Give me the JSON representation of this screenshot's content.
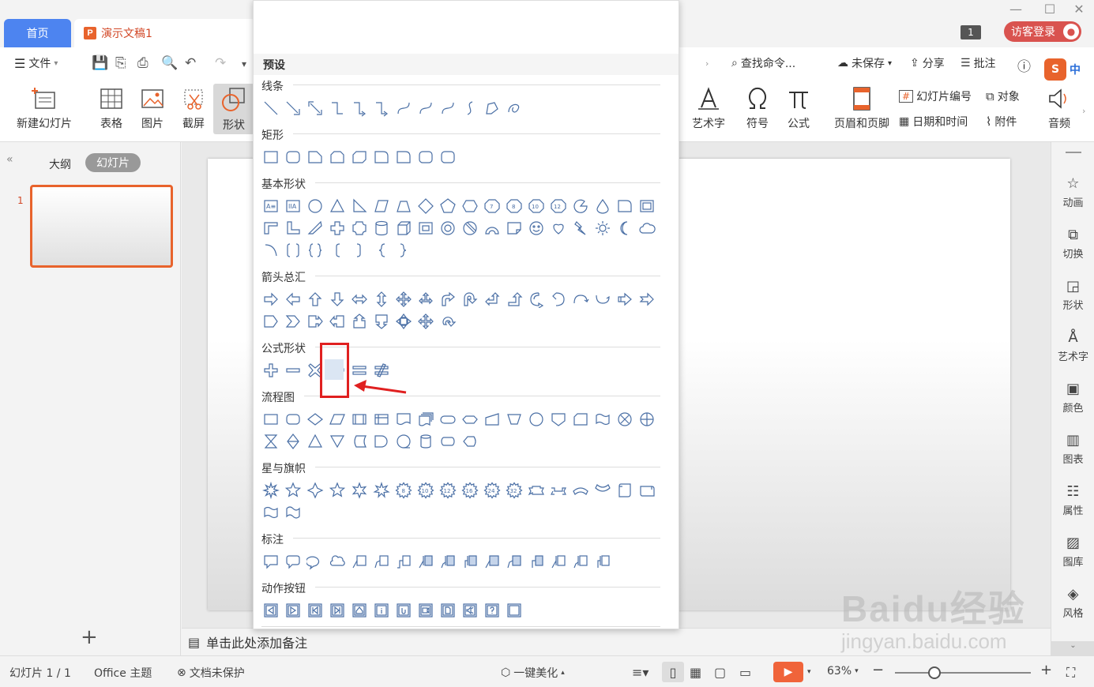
{
  "titlebar": {
    "home_tab": "首页",
    "doc_tab": "演示文稿1",
    "page_badge": "1",
    "guest_login": "访客登录"
  },
  "menu": {
    "file": "文件",
    "search": "查找命令...",
    "unsaved": "未保存",
    "share": "分享",
    "comment": "批注",
    "ime_label": "中"
  },
  "ribbon": {
    "new_slide": "新建幻灯片",
    "table": "表格",
    "picture": "图片",
    "screenshot": "截屏",
    "shape": "形状",
    "wordart": "艺术字",
    "symbol": "符号",
    "formula": "公式",
    "header_footer": "页眉和页脚",
    "slide_number": "幻灯片编号",
    "object": "对象",
    "datetime": "日期和时间",
    "attachment": "附件",
    "audio": "音频"
  },
  "leftpane": {
    "outline": "大纲",
    "slides": "幻灯片",
    "slide_number": "1",
    "add": "+"
  },
  "notes": {
    "placeholder": "单击此处添加备注"
  },
  "rightbar": [
    {
      "label": "动画",
      "icon": "star-icon"
    },
    {
      "label": "切换",
      "icon": "switch-icon"
    },
    {
      "label": "形状",
      "icon": "shapes-icon"
    },
    {
      "label": "艺术字",
      "icon": "wordart-icon"
    },
    {
      "label": "颜色",
      "icon": "grid-icon"
    },
    {
      "label": "图表",
      "icon": "chart-icon"
    },
    {
      "label": "属性",
      "icon": "sliders-icon"
    },
    {
      "label": "图库",
      "icon": "image-icon"
    },
    {
      "label": "风格",
      "icon": "style-icon"
    }
  ],
  "statusbar": {
    "slide_info": "幻灯片 1 / 1",
    "theme": "Office 主题",
    "protection": "文档未保护",
    "beautify": "一键美化",
    "zoom": "63%"
  },
  "dropdown": {
    "header": "预设",
    "sections": {
      "lines": "线条",
      "rectangles": "矩形",
      "basic": "基本形状",
      "arrows": "箭头总汇",
      "equation": "公式形状",
      "flowchart": "流程图",
      "stars": "星与旗帜",
      "callouts": "标注",
      "actions": "动作按钮"
    }
  },
  "watermark": {
    "brand": "Baidu经验",
    "url": "jingyan.baidu.com"
  },
  "colors": {
    "accent_blue": "#4d84f0",
    "wps_orange": "#e8632c",
    "shape_stroke": "#4a6fa5",
    "highlight_red": "#e02020"
  }
}
